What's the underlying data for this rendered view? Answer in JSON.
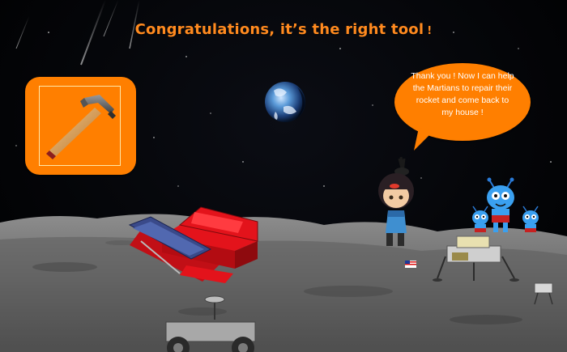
{
  "header": {
    "title": "Congratulations, it’s the right tool",
    "exclaim": "!"
  },
  "tool_card": {
    "icon": "hammer-icon",
    "color": "#ff7f00"
  },
  "speech_bubble": {
    "text": "Thank you ! Now I can help the Martians to repair their rocket and come back to my house !",
    "color": "#ff7f00"
  },
  "scene": {
    "setting": "moon-surface",
    "colors": {
      "accent": "#ff7f00",
      "title": "#ff8a1f",
      "toolbox": "#e3131b",
      "sky": "#000000"
    }
  }
}
